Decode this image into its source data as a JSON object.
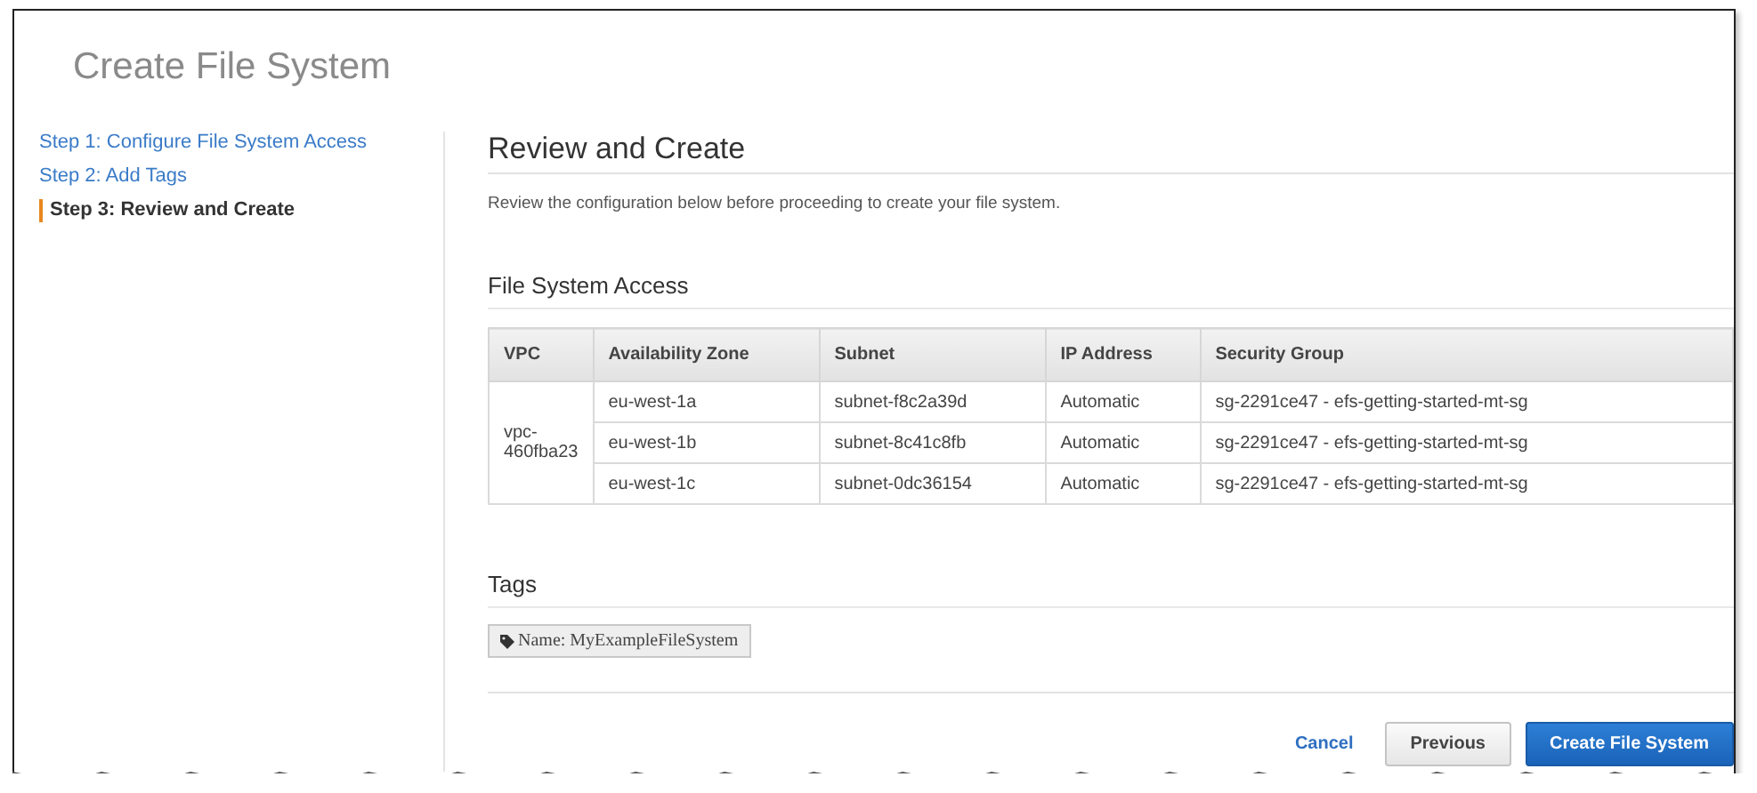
{
  "page": {
    "title": "Create File System"
  },
  "steps": [
    {
      "label": "Step 1: Configure File System Access",
      "selected": false
    },
    {
      "label": "Step 2: Add Tags",
      "selected": false
    },
    {
      "label": "Step 3: Review and Create",
      "selected": true
    }
  ],
  "review": {
    "heading": "Review and Create",
    "description": "Review the configuration below before proceeding to create your file system."
  },
  "access": {
    "heading": "File System Access",
    "columns": [
      "VPC",
      "Availability Zone",
      "Subnet",
      "IP Address",
      "Security Group"
    ],
    "vpc": "vpc-460fba23",
    "rows": [
      {
        "zone": "eu-west-1a",
        "subnet": "subnet-f8c2a39d",
        "ip": "Automatic",
        "group": "sg-2291ce47 - efs-getting-started-mt-sg"
      },
      {
        "zone": "eu-west-1b",
        "subnet": "subnet-8c41c8fb",
        "ip": "Automatic",
        "group": "sg-2291ce47 - efs-getting-started-mt-sg"
      },
      {
        "zone": "eu-west-1c",
        "subnet": "subnet-0dc36154",
        "ip": "Automatic",
        "group": "sg-2291ce47 - efs-getting-started-mt-sg"
      }
    ]
  },
  "tags": {
    "heading": "Tags",
    "items": [
      "Name: MyExampleFileSystem"
    ]
  },
  "actions": {
    "cancel": "Cancel",
    "previous": "Previous",
    "create": "Create File System"
  }
}
